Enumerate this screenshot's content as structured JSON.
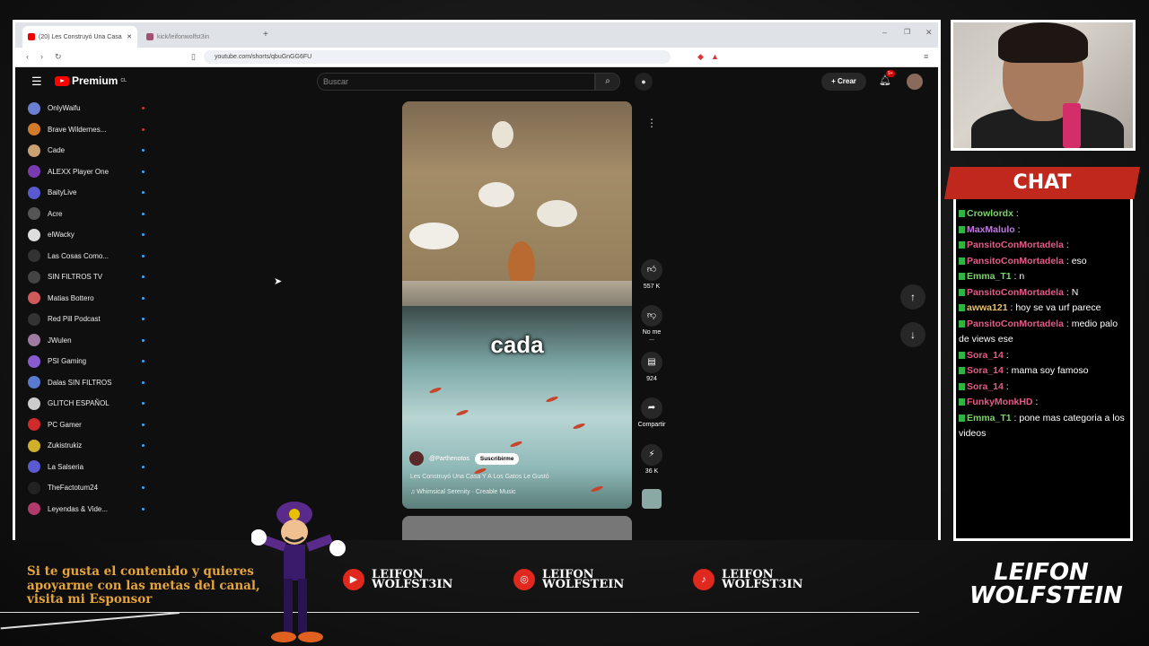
{
  "browser": {
    "tabs": [
      {
        "label": "(20) Les Construyó Una Casa"
      },
      {
        "label": "kick/leifonwolfst3in"
      }
    ],
    "url": "youtube.com/shorts/qbuGnGG6FU"
  },
  "youtube": {
    "logo": "Premium",
    "logo_sup": "CL",
    "search_placeholder": "Buscar",
    "create_label": "Crear",
    "notif_count": "9+",
    "subscriptions": [
      {
        "name": "OnlyWaifu",
        "color": "#6a7fd0"
      },
      {
        "name": "Brave Wildernes...",
        "color": "#d07a2a"
      },
      {
        "name": "Cade",
        "color": "#c9a070"
      },
      {
        "name": "ALEXX Player One",
        "color": "#7a3ab0"
      },
      {
        "name": "BaityLive",
        "color": "#5a5ad0"
      },
      {
        "name": "Acre",
        "color": "#555"
      },
      {
        "name": "elWacky",
        "color": "#ddd"
      },
      {
        "name": "Las Cosas Como...",
        "color": "#333"
      },
      {
        "name": "SIN FILTROS TV",
        "color": "#444"
      },
      {
        "name": "Matias Bottero",
        "color": "#d05a5a"
      },
      {
        "name": "Red Pill Podcast",
        "color": "#333"
      },
      {
        "name": "JWulen",
        "color": "#a07aa0"
      },
      {
        "name": "PSI Gaming",
        "color": "#8a5ad0"
      },
      {
        "name": "Dalas SIN FILTROS",
        "color": "#5a7ad0"
      },
      {
        "name": "GLITCH ESPAÑOL",
        "color": "#ccc"
      },
      {
        "name": "PC Gamer",
        "color": "#d02a2a"
      },
      {
        "name": "Zukistrukiz",
        "color": "#d0b02a"
      },
      {
        "name": "La Salseria",
        "color": "#5a5ad0"
      },
      {
        "name": "TheFactotum24",
        "color": "#222"
      },
      {
        "name": "Leyendas & Vide...",
        "color": "#b03a6a"
      }
    ],
    "short": {
      "caption": "cada",
      "channel": "@Parthenotos",
      "subscribe": "Suscribirme",
      "title": "Les Construyó Una Casa Y A Los Gatos Le Gustó",
      "music": "♫ Whimsical Serenity · Creable Music"
    },
    "actions": {
      "likes": "557 K",
      "dislike": "No me ...",
      "comments": "924",
      "share": "Compartir",
      "remix": "36 K"
    }
  },
  "chat": {
    "title": "CHAT",
    "messages": [
      {
        "user": "Crowlordx",
        "color": "#7bd46a",
        "text": ""
      },
      {
        "user": "MaxMalulo",
        "color": "#c07ae0",
        "text": ""
      },
      {
        "user": "PansitoConMortadela",
        "color": "#e65a8a",
        "text": ""
      },
      {
        "user": "PansitoConMortadela",
        "color": "#e65a8a",
        "text": "eso"
      },
      {
        "user": "Emma_T1",
        "color": "#7bd46a",
        "text": "n"
      },
      {
        "user": "PansitoConMortadela",
        "color": "#e65a8a",
        "text": "N"
      },
      {
        "user": "awwa121",
        "color": "#e6c06a",
        "text": "hoy se va urf parece"
      },
      {
        "user": "PansitoConMortadela",
        "color": "#e65a8a",
        "text": "medio palo de views ese"
      },
      {
        "user": "Sora_14",
        "color": "#e65a8a",
        "text": ""
      },
      {
        "user": "Sora_14",
        "color": "#e65a8a",
        "text": "mama soy famoso"
      },
      {
        "user": "Sora_14",
        "color": "#e65a8a",
        "text": ""
      },
      {
        "user": "FunkyMonkHD",
        "color": "#e65a8a",
        "text": ""
      },
      {
        "user": "Emma_T1",
        "color": "#7bd46a",
        "text": "pone mas categoria a los videos"
      }
    ]
  },
  "overlay": {
    "sponsor_text": "Si te gusta el contenido y quieres apoyarme con las metas del canal, visita mi Esponsor",
    "socials": [
      {
        "icon": "youtube-icon",
        "line1": "LEIFON",
        "line2": "WOLFST3IN"
      },
      {
        "icon": "instagram-icon",
        "line1": "LEIFON",
        "line2": "WOLFSTEIN"
      },
      {
        "icon": "tiktok-icon",
        "line1": "LEIFON",
        "line2": "WOLFST3IN"
      }
    ],
    "logo_line1": "LEIFON",
    "logo_line2": "WOLFSTEIN"
  }
}
